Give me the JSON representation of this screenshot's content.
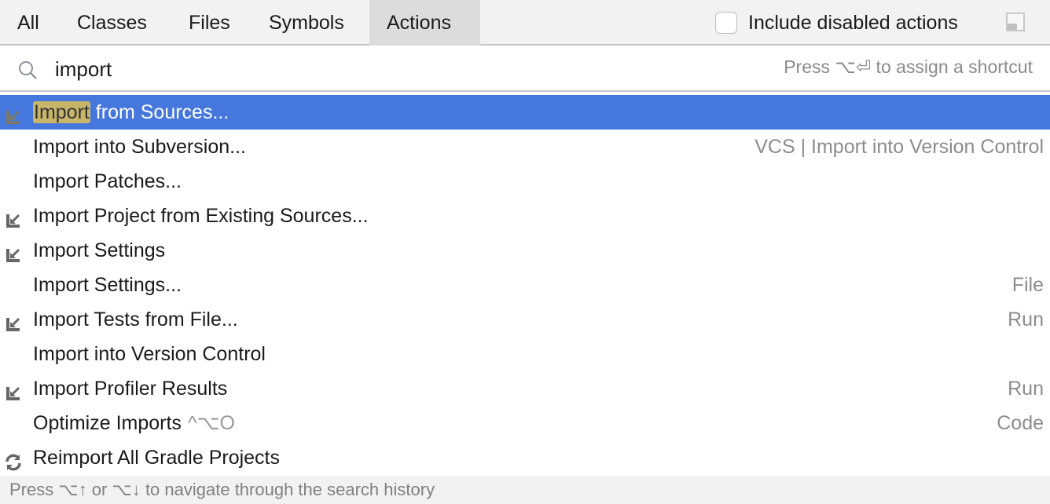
{
  "tabs": [
    {
      "label": "All"
    },
    {
      "label": "Classes"
    },
    {
      "label": "Files"
    },
    {
      "label": "Symbols"
    },
    {
      "label": "Actions",
      "active": true
    }
  ],
  "include_disabled": {
    "label": "Include disabled actions",
    "checked": false
  },
  "search": {
    "value": "import",
    "hint": "Press ⌥⏎ to assign a shortcut"
  },
  "results": [
    {
      "match": "Import",
      "rest": " from Sources...",
      "group": "",
      "icon": "import-arrow-icon",
      "selected": true
    },
    {
      "label": "Import into Subversion...",
      "group": "VCS | Import into Version Control",
      "icon": ""
    },
    {
      "label": "Import Patches...",
      "group": "",
      "icon": ""
    },
    {
      "label": "Import Project from Existing Sources...",
      "group": "",
      "icon": "import-arrow-icon"
    },
    {
      "label": "Import Settings",
      "group": "",
      "icon": "import-arrow-icon"
    },
    {
      "label": "Import Settings...",
      "group": "File",
      "icon": ""
    },
    {
      "label": "Import Tests from File...",
      "group": "Run",
      "icon": "import-arrow-icon"
    },
    {
      "label": "Import into Version Control",
      "group": "",
      "icon": ""
    },
    {
      "label": "Import Profiler Results",
      "group": "Run",
      "icon": "import-arrow-icon"
    },
    {
      "label": "Optimize Imports",
      "shortcut": "^⌥O",
      "group": "Code",
      "icon": ""
    },
    {
      "label": "Reimport All Gradle Projects",
      "group": "",
      "icon": "refresh-icon"
    }
  ],
  "footer": "Press ⌥↑ or ⌥↓ to navigate through the search history",
  "colors": {
    "selection": "#4677dc",
    "highlight": "#c9b56a"
  }
}
